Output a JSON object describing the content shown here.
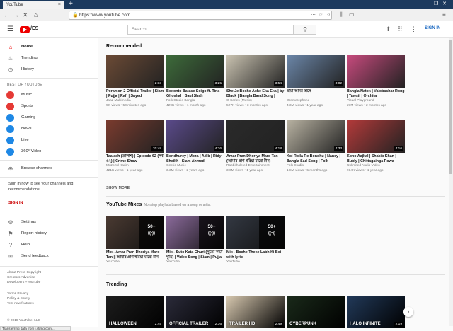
{
  "browser": {
    "tab_title": "YouTube",
    "url": "https://www.youtube.com",
    "status_text": "Transferring data from i.ytimg.com..."
  },
  "header": {
    "logo_text": "/ES",
    "search_placeholder": "Search",
    "signin": "SIGN IN"
  },
  "sidebar": {
    "nav": [
      {
        "label": "Home",
        "icon": "home-icon"
      },
      {
        "label": "Trending",
        "icon": "flame-icon"
      },
      {
        "label": "History",
        "icon": "history-icon"
      }
    ],
    "best_title": "BEST OF YOUTUBE",
    "best": [
      {
        "label": "Music",
        "color": "#e53935"
      },
      {
        "label": "Sports",
        "color": "#e53935"
      },
      {
        "label": "Gaming",
        "color": "#1e88e5"
      },
      {
        "label": "News",
        "color": "#1e88e5"
      },
      {
        "label": "Live",
        "color": "#1e88e5"
      },
      {
        "label": "360° Video",
        "color": "#1e88e5"
      }
    ],
    "browse": "Browse channels",
    "signin_text": "Sign in now to see your channels and recommendations!",
    "signin_link": "SIGN IN",
    "settings": [
      {
        "label": "Settings"
      },
      {
        "label": "Report history"
      },
      {
        "label": "Help"
      },
      {
        "label": "Send feedback"
      }
    ],
    "footer1": "About  Press  Copyright\nCreators  Advertise\nDevelopers  +YouTube",
    "footer2": "Terms  Privacy\nPolicy & Safety\nTest new features",
    "footer3": "© 2018 YouTube, LLC"
  },
  "recommended": {
    "title": "Recommended",
    "show_more": "SHOW MORE",
    "row1": [
      {
        "title": "Poramon 2 Official Trailer | Siam | Pujja | Rafi | Sayed",
        "channel": "Jaaz Multimedia",
        "meta": "9K views • 50 minutes ago",
        "duration": "2:33",
        "color": "#6b4a35"
      },
      {
        "title": "Boxonto Batase Soigo ft. Tina Ghoshal | Baul Shah",
        "channel": "Folk Studio Bangla",
        "meta": "429K views • 1 month ago",
        "duration": "3:25",
        "color": "#3d6b3a"
      },
      {
        "title": "She Je Boshe Ache Eka Eka | by Black | Bangla Band Song |",
        "channel": "G Series (Music)",
        "meta": "527K views • 3 months ago",
        "duration": "3:54",
        "color": "#c9c2b0"
      },
      {
        "title": "ছায়া আদর অঙ্গে",
        "channel": "Gramerephone",
        "meta": "4.3M views • 1 year ago",
        "duration": "3:02",
        "color": "#6b86a8"
      },
      {
        "title": "Bangla Natok | Valobashar Rong | Tawsif | Orchita",
        "channel": "Visual Playground",
        "meta": "27M views • 2 months ago",
        "duration": "",
        "color": "#c74a7d"
      }
    ],
    "row2": [
      {
        "title": "Taalash (তালাশ) | Episode 62 (পর্ব ৬২) | Crime Show",
        "channel": "Muzozul Karim",
        "meta": "421K views • 1 year ago",
        "duration": "20:48",
        "color": "#7a3b2e"
      },
      {
        "title": "Bondhurey | Moza | Adib | Ridy Sheikh | Siam Ahmed",
        "channel": "Gnetic Music",
        "meta": "3.3M views • 2 years ago",
        "duration": "4:36",
        "color": "#5a4a8a"
      },
      {
        "title": "Amar Pran Dhoriya Maro Tan (আমার প্রাণ ধরিয়া মারো টান)",
        "channel": "Rabbitholeled Entertainment",
        "meta": "3.6M views • 1 year ago",
        "duration": "4:18",
        "color": "#2a2a2a"
      },
      {
        "title": "Koi Roila Re Bondhu | Nancy | Bangla Sad Song | Folk",
        "channel": "Folk Studio",
        "meta": "1.8M views • 5 months ago",
        "duration": "4:33",
        "color": "#b8b2a2"
      },
      {
        "title": "Kono Aajkal | Shakib Khan | Bubly | Chittagainga Powa",
        "channel": "Unlimited Audio Video",
        "meta": "914K views • 1 year ago",
        "duration": "4:16",
        "color": "#b33a3a"
      }
    ]
  },
  "mixes": {
    "title": "YouTube Mixes",
    "subtitle": "Nonstop playlists based on a song or artist",
    "items": [
      {
        "title": "Mix - Amar Pran Dhoriya Maro Tan || আমার প্রাণ ধরিয়া মারো টান",
        "channel": "YouTube",
        "count": "50+",
        "color": "#4a3a32"
      },
      {
        "title": "Mix - Suto Kata Ghuri (সুতো কাটা ঘুড়ি) | Video Song | Siam | Pujja",
        "channel": "YouTube",
        "count": "50+",
        "color": "#8a6a9a"
      },
      {
        "title": "Mix - Boche Theke Labh Ki Boi with lyric",
        "channel": "YouTube",
        "count": "50+",
        "color": "#333842"
      }
    ]
  },
  "trending": {
    "title": "Trending",
    "items": [
      {
        "duration": "2:45",
        "color": "#1d1d1d",
        "caption": "HALLOWEEN"
      },
      {
        "duration": "2:36",
        "color": "#2b2b3a",
        "caption": "OFFICIAL TRAILER"
      },
      {
        "duration": "2:49",
        "color": "#d8c9b0",
        "caption": "TRAILER HD"
      },
      {
        "duration": "",
        "color": "#1a2a1a",
        "caption": "CYBERPUNK"
      },
      {
        "duration": "2:19",
        "color": "#223a5a",
        "caption": "HALO INFINITE"
      }
    ]
  }
}
